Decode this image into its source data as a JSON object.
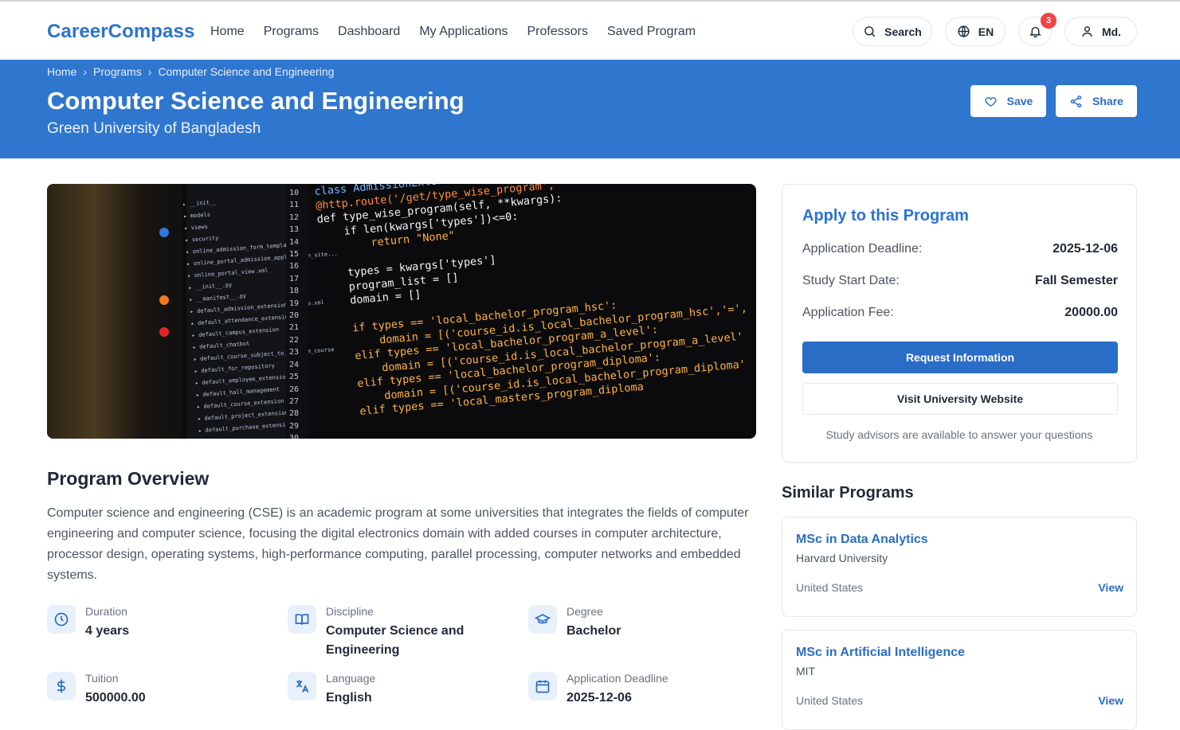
{
  "header": {
    "brand": "CareerCompass",
    "nav": [
      "Home",
      "Programs",
      "Dashboard",
      "My Applications",
      "Professors",
      "Saved Program"
    ],
    "search_label": "Search",
    "lang_label": "EN",
    "notification_count": "3",
    "user_label": "Md."
  },
  "breadcrumb": [
    "Home",
    "Programs",
    "Computer Science and Engineering"
  ],
  "program": {
    "title": "Computer Science and Engineering",
    "university": "Green University of Bangladesh",
    "save_label": "Save",
    "share_label": "Share"
  },
  "hero": {
    "line_numbers": "10\n11\n12\n13\n14\n15\n16\n17\n18\n19\n20\n21\n22\n23\n24\n25\n26\n27\n28\n29\n30",
    "code": [
      "class AdmissionExtension(http.Controller, website",
      "@http.route('/get/type_wise_program', ",
      "def type_wise_program(self, **kwargs):",
      "    if len(kwargs['types'])<=0:",
      "        return \"None\"",
      "",
      "    types = kwargs['types']",
      "    program_list = []",
      "    domain = []",
      "",
      "    if types == 'local_bachelor_program_hsc':",
      "        domain = [('course_id.is_local_bachelor_program_hsc','=',",
      "    elif types == 'local_bachelor_program_a_level':",
      "        domain = [('course_id.is_local_bachelor_program_a_level'",
      "    elif types == 'local_bachelor_program_diploma':",
      "        domain = [('course_id.is_local_bachelor_program_diploma'",
      "    elif types == 'local_masters_program_diploma"
    ]
  },
  "overview": {
    "heading": "Program Overview",
    "text": "Computer science and engineering (CSE) is an academic program at some universities that integrates the fields of computer engineering and computer science, focusing the digital electronics domain with added courses in computer architecture, processor design, operating systems, high-performance computing, parallel processing, computer networks and embedded systems.",
    "facts": [
      {
        "label": "Duration",
        "value": "4 years",
        "icon": "clock-icon"
      },
      {
        "label": "Discipline",
        "value": "Computer Science and Engineering",
        "icon": "book-icon"
      },
      {
        "label": "Degree",
        "value": "Bachelor",
        "icon": "graduation-cap-icon"
      },
      {
        "label": "Tuition",
        "value": "500000.00",
        "icon": "dollar-icon"
      },
      {
        "label": "Language",
        "value": "English",
        "icon": "language-icon"
      },
      {
        "label": "Application Deadline",
        "value": "2025-12-06",
        "icon": "calendar-icon"
      }
    ]
  },
  "apply": {
    "heading": "Apply to this Program",
    "rows": [
      {
        "label": "Application Deadline:",
        "value": "2025-12-06"
      },
      {
        "label": "Study Start Date:",
        "value": "Fall Semester"
      },
      {
        "label": "Application Fee:",
        "value": "20000.00"
      }
    ],
    "request_label": "Request Information",
    "visit_label": "Visit University Website",
    "note": "Study advisors are available to answer your questions"
  },
  "similar": {
    "heading": "Similar Programs",
    "items": [
      {
        "title": "MSc in Data Analytics",
        "university": "Harvard University",
        "country": "United States",
        "action": "View"
      },
      {
        "title": "MSc in Artificial Intelligence",
        "university": "MIT",
        "country": "United States",
        "action": "View"
      }
    ]
  },
  "colors": {
    "brand": "#2a73d0",
    "banner": "#2f76cf",
    "badge": "#ef4444"
  }
}
